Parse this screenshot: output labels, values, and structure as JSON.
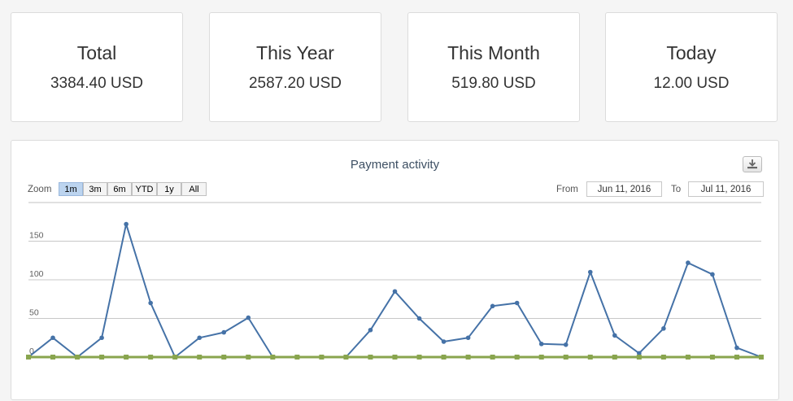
{
  "stats": [
    {
      "title": "Total",
      "value": "3384.40 USD"
    },
    {
      "title": "This Year",
      "value": "2587.20 USD"
    },
    {
      "title": "This Month",
      "value": "519.80 USD"
    },
    {
      "title": "Today",
      "value": "12.00 USD"
    }
  ],
  "chart": {
    "title": "Payment activity",
    "zoom_label": "Zoom",
    "zoom_buttons": [
      "1m",
      "3m",
      "6m",
      "YTD",
      "1y",
      "All"
    ],
    "zoom_active": "1m",
    "from_label": "From",
    "from_value": "Jun 11, 2016",
    "to_label": "To",
    "to_value": "Jul 11, 2016",
    "export_icon": "download-icon"
  },
  "chart_data": {
    "type": "line",
    "title": "Payment activity",
    "ylim": [
      0,
      200
    ],
    "yticks": [
      0,
      50,
      100,
      150
    ],
    "grid": true,
    "series": [
      {
        "color": "#4572a7",
        "values": [
          0,
          25,
          0,
          25,
          172,
          70,
          0,
          25,
          32,
          51,
          0,
          0,
          0,
          0,
          35,
          85,
          50,
          20,
          25,
          66,
          70,
          17,
          16,
          110,
          28,
          5,
          37,
          122,
          107,
          12,
          0
        ]
      },
      {
        "color": "#89a54e",
        "values": [
          0,
          0,
          0,
          0,
          0,
          0,
          0,
          0,
          0,
          0,
          0,
          0,
          0,
          0,
          0,
          0,
          0,
          0,
          0,
          0,
          0,
          0,
          0,
          0,
          0,
          0,
          0,
          0,
          0,
          0,
          0
        ]
      }
    ]
  }
}
